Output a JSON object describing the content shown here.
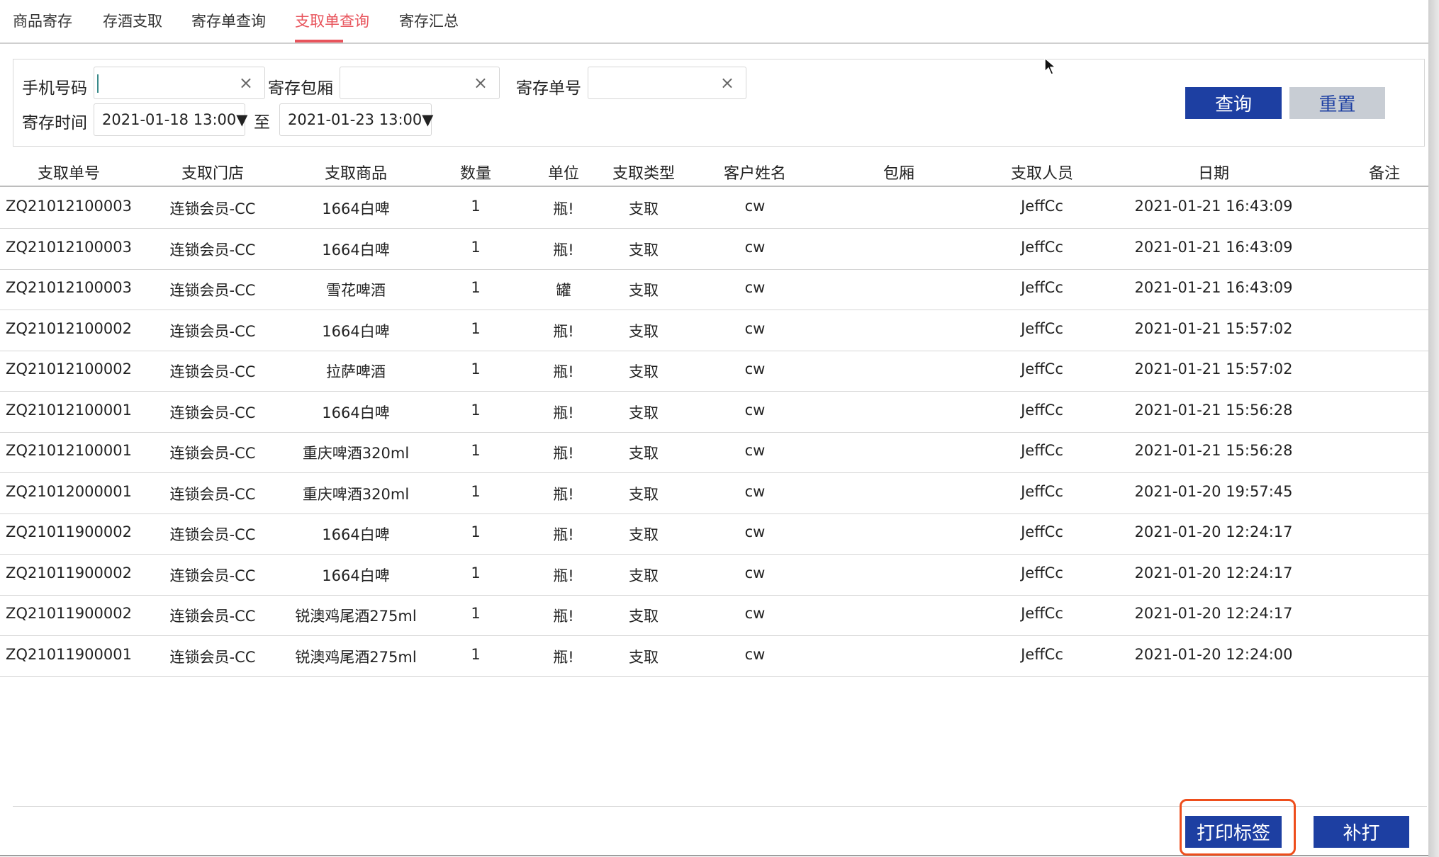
{
  "tabs": [
    {
      "label": "商品寄存"
    },
    {
      "label": "存酒支取"
    },
    {
      "label": "寄存单查询"
    },
    {
      "label": "支取单查询"
    },
    {
      "label": "寄存汇总"
    }
  ],
  "filters": {
    "phone_label": "手机号码",
    "phone_value": "",
    "room_label": "寄存包厢",
    "room_value": "",
    "order_label": "寄存单号",
    "order_value": "",
    "time_label": "寄存时间",
    "start_time": "2021-01-18 13:00",
    "range_separator": "至",
    "end_time": "2021-01-23 13:00",
    "query_button": "查询",
    "reset_button": "重置"
  },
  "icons": {
    "clear": "close-icon",
    "dropdown": "dropdown-triangle-icon",
    "cursor": "mouse-pointer-icon"
  },
  "colors": {
    "active_tab": "#e8545c",
    "primary_button": "#1d3fa2",
    "secondary_button": "#c8cdd4",
    "highlight_box": "#ee4e1c"
  },
  "table": {
    "columns": [
      "支取单号",
      "支取门店",
      "支取商品",
      "数量",
      "单位",
      "支取类型",
      "客户姓名",
      "包厢",
      "支取人员",
      "日期",
      "备注"
    ],
    "rows": [
      [
        "ZQ21012100003",
        "连锁会员-CC",
        "1664白啤",
        "1",
        "瓶!",
        "支取",
        "cw",
        "",
        "JeffCc",
        "2021-01-21 16:43:09",
        ""
      ],
      [
        "ZQ21012100003",
        "连锁会员-CC",
        "1664白啤",
        "1",
        "瓶!",
        "支取",
        "cw",
        "",
        "JeffCc",
        "2021-01-21 16:43:09",
        ""
      ],
      [
        "ZQ21012100003",
        "连锁会员-CC",
        "雪花啤酒",
        "1",
        "罐",
        "支取",
        "cw",
        "",
        "JeffCc",
        "2021-01-21 16:43:09",
        ""
      ],
      [
        "ZQ21012100002",
        "连锁会员-CC",
        "1664白啤",
        "1",
        "瓶!",
        "支取",
        "cw",
        "",
        "JeffCc",
        "2021-01-21 15:57:02",
        ""
      ],
      [
        "ZQ21012100002",
        "连锁会员-CC",
        "拉萨啤酒",
        "1",
        "瓶!",
        "支取",
        "cw",
        "",
        "JeffCc",
        "2021-01-21 15:57:02",
        ""
      ],
      [
        "ZQ21012100001",
        "连锁会员-CC",
        "1664白啤",
        "1",
        "瓶!",
        "支取",
        "cw",
        "",
        "JeffCc",
        "2021-01-21 15:56:28",
        ""
      ],
      [
        "ZQ21012100001",
        "连锁会员-CC",
        "重庆啤酒320ml",
        "1",
        "瓶!",
        "支取",
        "cw",
        "",
        "JeffCc",
        "2021-01-21 15:56:28",
        ""
      ],
      [
        "ZQ21012000001",
        "连锁会员-CC",
        "重庆啤酒320ml",
        "1",
        "瓶!",
        "支取",
        "cw",
        "",
        "JeffCc",
        "2021-01-20 19:57:45",
        ""
      ],
      [
        "ZQ21011900002",
        "连锁会员-CC",
        "1664白啤",
        "1",
        "瓶!",
        "支取",
        "cw",
        "",
        "JeffCc",
        "2021-01-20 12:24:17",
        ""
      ],
      [
        "ZQ21011900002",
        "连锁会员-CC",
        "1664白啤",
        "1",
        "瓶!",
        "支取",
        "cw",
        "",
        "JeffCc",
        "2021-01-20 12:24:17",
        ""
      ],
      [
        "ZQ21011900002",
        "连锁会员-CC",
        "锐澳鸡尾酒275ml",
        "1",
        "瓶!",
        "支取",
        "cw",
        "",
        "JeffCc",
        "2021-01-20 12:24:17",
        ""
      ],
      [
        "ZQ21011900001",
        "连锁会员-CC",
        "锐澳鸡尾酒275ml",
        "1",
        "瓶!",
        "支取",
        "cw",
        "",
        "JeffCc",
        "2021-01-20 12:24:00",
        ""
      ]
    ]
  },
  "footer": {
    "print_label_button": "打印标签",
    "reprint_button": "补打"
  }
}
